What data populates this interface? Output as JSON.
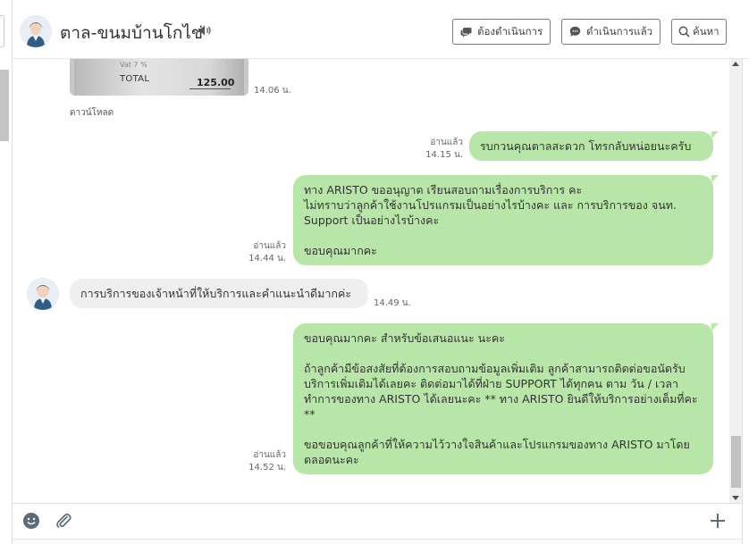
{
  "header": {
    "title": "ตาล-ขนมบ้านโกไข่",
    "buttons": {
      "pending": "ต้องดำเนินการ",
      "done": "ดำเนินการแล้ว",
      "search": "ค้นหา"
    }
  },
  "receipt_image": {
    "vat_label": "Vat 7 %",
    "total_label": "TOTAL",
    "total_value": "125.00",
    "time": "14.06 น.",
    "download_label": "ดาวน์โหลด"
  },
  "messages": [
    {
      "direction": "outgoing",
      "read_label": "อ่านแล้ว",
      "time": "14.15 น.",
      "paragraphs": [
        "รบกวนคุณตาลสะดวก โทรกลับหน่อยนะครับ"
      ]
    },
    {
      "direction": "outgoing",
      "read_label": "อ่านแล้ว",
      "time": "14.44 น.",
      "paragraphs": [
        "ทาง ARISTO ขออนุญาต เรียนสอบถามเรื่องการบริการ คะ\nไม่ทราบว่าลูกค้าใช้งานโปรแกรมเป็นอย่างไรบ้างคะ และ การบริการของ จนท. Support เป็นอย่างไรบ้างคะ",
        "ขอบคุณมากคะ"
      ]
    },
    {
      "direction": "incoming",
      "time": "14.49 น.",
      "paragraphs": [
        "การบริการของเจ้าหน้าที่ให้บริการและคำแนะนำดีมากค่ะ"
      ]
    },
    {
      "direction": "outgoing",
      "read_label": "อ่านแล้ว",
      "time": "14.52 น.",
      "paragraphs": [
        "ขอบคุณมากคะ สำหรับข้อเสนอแนะ นะคะ",
        "ถ้าลูกค้ามีข้อสงสัยที่ต้องการสอบถามข้อมูลเพิ่มเติม ลูกค้าสามารถติดต่อขอนัดรับบริการเพิ่มเติมได้เลยคะ ติดต่อมาได้ที่ฝ่าย SUPPORT ได้ทุกคน ตาม วัน / เวลา ทำการของทาง ARISTO ได้เลยนะคะ ** ทาง ARISTO ยินดีให้บริการอย่างเต็มที่คะ **",
        "ขอขอบคุณลูกค้าที่ให้ความไว้วางใจสินค้าและโปรแกรมของทาง ARISTO มาโดยตลอดนะคะ"
      ]
    }
  ],
  "icons": {
    "speaker": "speaker-icon",
    "pending": "chat-bubble-icon",
    "done": "chat-dots-icon",
    "search": "search-icon",
    "emoji": "emoji-icon",
    "attach": "paperclip-icon",
    "add": "plus-icon"
  },
  "colors": {
    "outgoing_bubble": "#b8e6a8",
    "incoming_bubble": "#efefef"
  }
}
